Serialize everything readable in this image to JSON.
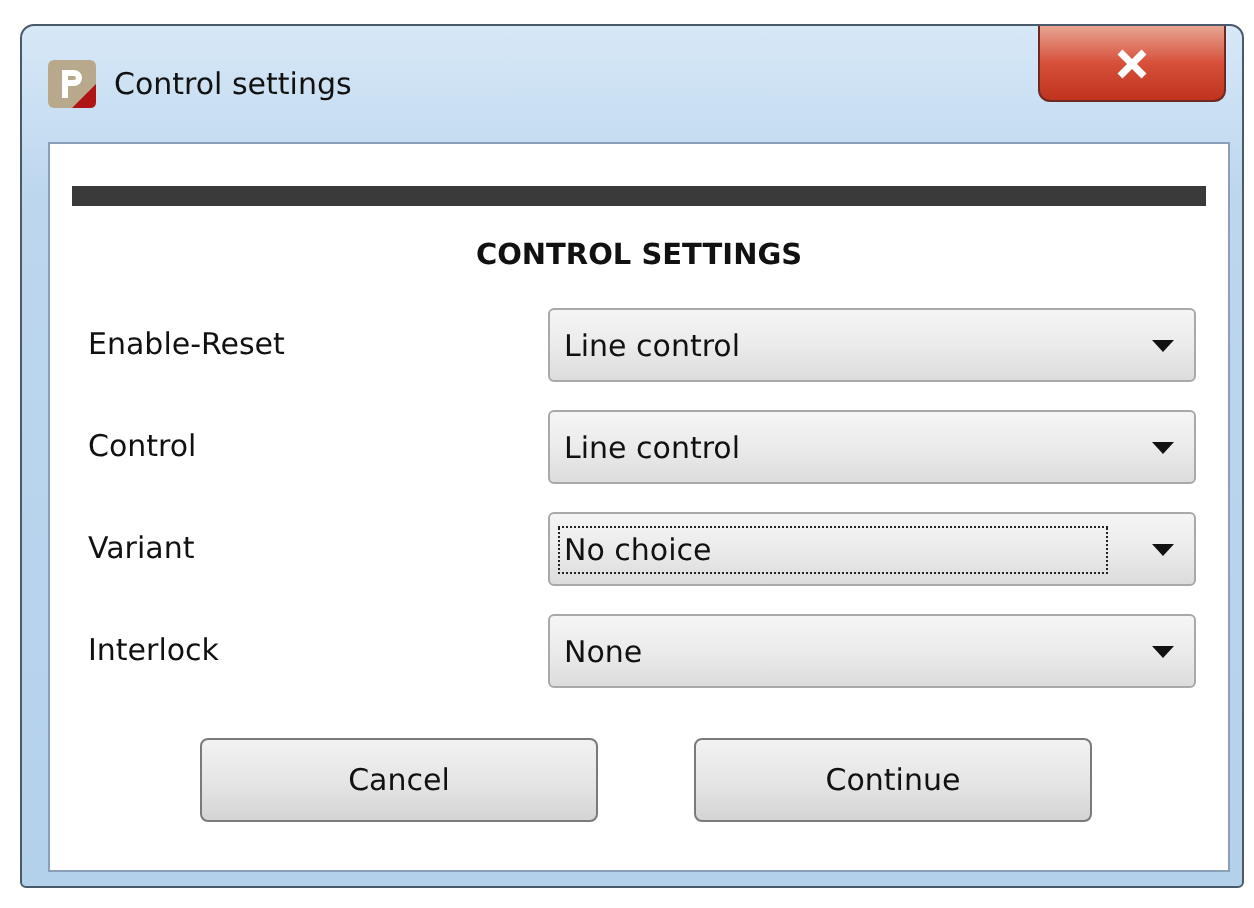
{
  "window": {
    "title": "Control settings"
  },
  "heading": "CONTROL SETTINGS",
  "fields": [
    {
      "label": "Enable-Reset",
      "value": "Line control",
      "focused": false
    },
    {
      "label": "Control",
      "value": "Line control",
      "focused": false
    },
    {
      "label": "Variant",
      "value": "No choice",
      "focused": true
    },
    {
      "label": "Interlock",
      "value": "None",
      "focused": false
    }
  ],
  "buttons": [
    "Cancel",
    "Continue"
  ]
}
